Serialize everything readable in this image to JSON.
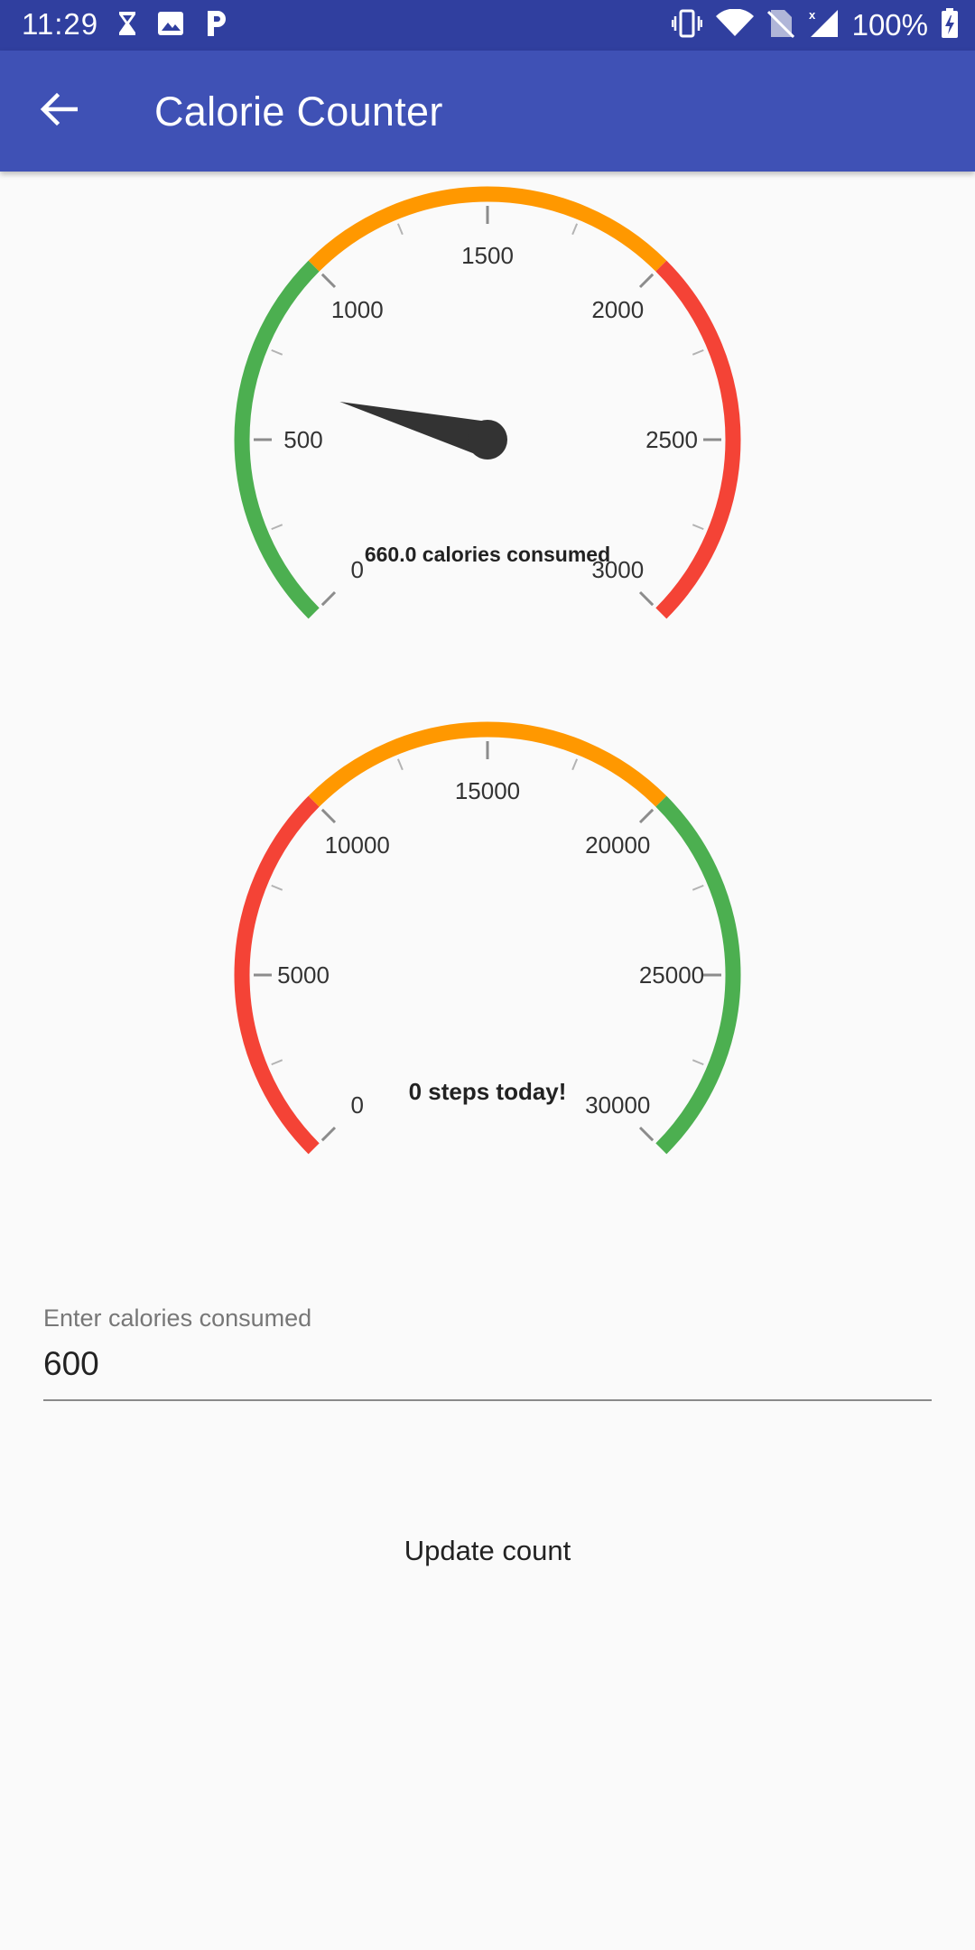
{
  "status_bar": {
    "time": "11:29",
    "battery_percent": "100%",
    "left_icons": [
      "hourglass-icon",
      "image-icon",
      "p-app-icon"
    ],
    "right_icons": [
      "vibrate-icon",
      "wifi-icon",
      "no-sim-icon",
      "signal-icon",
      "battery-charging-icon"
    ]
  },
  "app_bar": {
    "title": "Calorie Counter",
    "back_icon": "arrow-back-icon",
    "color": "#3f51b5",
    "status_color": "#303f9f"
  },
  "gauges": [
    {
      "id": "calories",
      "min": 0,
      "max": 3000,
      "value": 660.0,
      "major_labels": [
        "0",
        "500",
        "1000",
        "1500",
        "2000",
        "2500",
        "3000"
      ],
      "center_text": "660.0 calories consumed",
      "has_needle": true,
      "ranges": [
        {
          "from": 0,
          "to": 1000,
          "color": "#4caf50"
        },
        {
          "from": 1000,
          "to": 2000,
          "color": "#ff9800"
        },
        {
          "from": 2000,
          "to": 3000,
          "color": "#f44336"
        }
      ]
    },
    {
      "id": "steps",
      "min": 0,
      "max": 30000,
      "value": 0,
      "major_labels": [
        "0",
        "5000",
        "10000",
        "15000",
        "20000",
        "25000",
        "30000"
      ],
      "center_text": "0 steps today!",
      "has_needle": false,
      "ranges": [
        {
          "from": 0,
          "to": 10000,
          "color": "#f44336"
        },
        {
          "from": 10000,
          "to": 20000,
          "color": "#ff9800"
        },
        {
          "from": 20000,
          "to": 30000,
          "color": "#4caf50"
        }
      ]
    }
  ],
  "calorie_input": {
    "label": "Enter calories consumed",
    "value": "600"
  },
  "update_button": {
    "label": "Update count"
  }
}
